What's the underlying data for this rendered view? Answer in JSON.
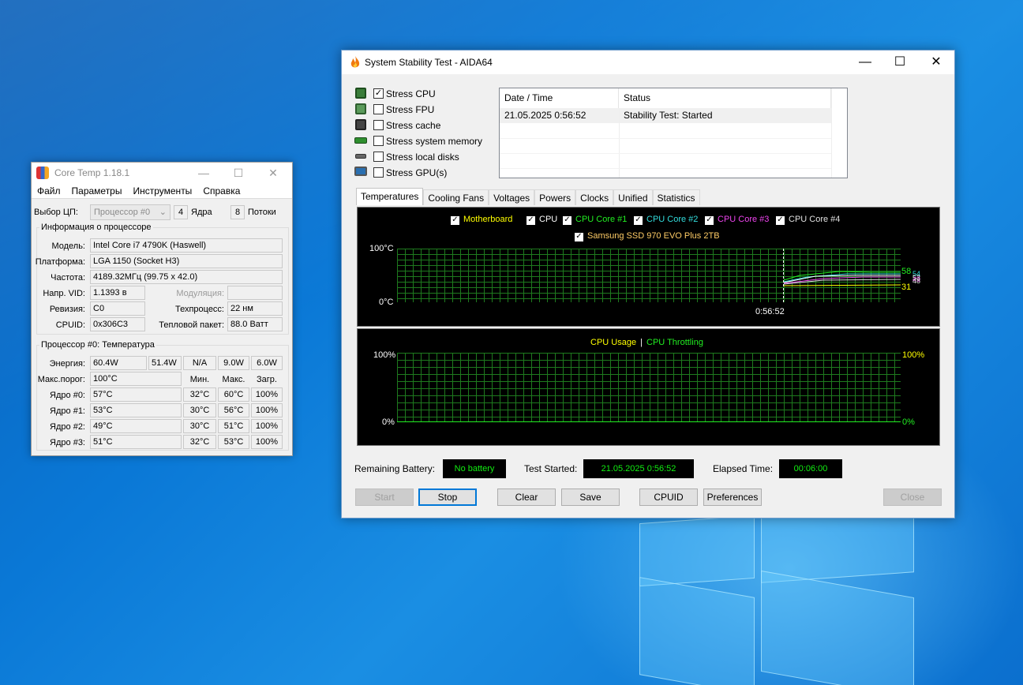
{
  "coretemp": {
    "title": "Core Temp 1.18.1",
    "menu": [
      "Файл",
      "Параметры",
      "Инструменты",
      "Справка"
    ],
    "cpu_select_label": "Выбор ЦП:",
    "cpu_select_value": "Процессор #0",
    "cores_value": "4",
    "cores_label": "Ядра",
    "threads_value": "8",
    "threads_label": "Потоки",
    "info_group": "Информация о процессоре",
    "model_label": "Модель:",
    "model_value": "Intel Core i7 4790K (Haswell)",
    "platform_label": "Платформа:",
    "platform_value": "LGA 1150 (Socket H3)",
    "freq_label": "Частота:",
    "freq_value": "4189.32МГц (99.75 x 42.0)",
    "vid_label": "Напр. VID:",
    "vid_value": "1.1393 в",
    "mod_label": "Модуляция:",
    "mod_value": "",
    "rev_label": "Ревизия:",
    "rev_value": "C0",
    "proc_label": "Техпроцесс:",
    "proc_value": "22 нм",
    "cpuid_label": "CPUID:",
    "cpuid_value": "0x306C3",
    "tdp_label": "Тепловой пакет:",
    "tdp_value": "88.0 Ватт",
    "temp_group": "Процессор #0: Температура",
    "power_label": "Энергия:",
    "power_values": [
      "60.4W",
      "51.4W",
      "N/A",
      "9.0W",
      "6.0W"
    ],
    "tjmax_label": "Макс.порог:",
    "tjmax_value": "100°C",
    "col_min": "Мин.",
    "col_max": "Макс.",
    "col_load": "Загр.",
    "cores": [
      {
        "label": "Ядро #0:",
        "temp": "57°C",
        "min": "32°C",
        "max": "60°C",
        "load": "100%"
      },
      {
        "label": "Ядро #1:",
        "temp": "53°C",
        "min": "30°C",
        "max": "56°C",
        "load": "100%"
      },
      {
        "label": "Ядро #2:",
        "temp": "49°C",
        "min": "30°C",
        "max": "51°C",
        "load": "100%"
      },
      {
        "label": "Ядро #3:",
        "temp": "51°C",
        "min": "32°C",
        "max": "53°C",
        "load": "100%"
      }
    ]
  },
  "aida": {
    "title": "System Stability Test - AIDA64",
    "stress": [
      {
        "label": "Stress CPU",
        "checked": "✓"
      },
      {
        "label": "Stress FPU",
        "checked": ""
      },
      {
        "label": "Stress cache",
        "checked": ""
      },
      {
        "label": "Stress system memory",
        "checked": ""
      },
      {
        "label": "Stress local disks",
        "checked": ""
      },
      {
        "label": "Stress GPU(s)",
        "checked": ""
      }
    ],
    "log": {
      "col_date": "Date / Time",
      "col_status": "Status",
      "rows": [
        {
          "date": "21.05.2025 0:56:52",
          "status": "Stability Test: Started"
        }
      ]
    },
    "tabs": [
      "Temperatures",
      "Cooling Fans",
      "Voltages",
      "Powers",
      "Clocks",
      "Unified",
      "Statistics"
    ],
    "temp_graph": {
      "legend": [
        {
          "label": "Motherboard",
          "color": "#ffff00"
        },
        {
          "label": "CPU",
          "color": "#ffffff"
        },
        {
          "label": "CPU Core #1",
          "color": "#22ee22"
        },
        {
          "label": "CPU Core #2",
          "color": "#33dddd"
        },
        {
          "label": "CPU Core #3",
          "color": "#ee44ee"
        },
        {
          "label": "CPU Core #4",
          "color": "#e0e0e0"
        },
        {
          "label": "Samsung SSD 970 EVO Plus 2TB",
          "color": "#ffcc66"
        }
      ],
      "y_top": "100°C",
      "y_bottom": "0°C",
      "time_label": "0:56:52",
      "right_values": [
        {
          "text": "58",
          "color": "#22ee22"
        },
        {
          "text": "54",
          "color": "#33dddd"
        },
        {
          "text": "53",
          "color": "#ffffff"
        },
        {
          "text": "49",
          "color": "#ee44ee"
        },
        {
          "text": "48",
          "color": "#e0e0e0"
        },
        {
          "text": "31",
          "color": "#ffff00"
        }
      ]
    },
    "usage_graph": {
      "legend_usage": "CPU Usage",
      "legend_sep": "|",
      "legend_throttle": "CPU Throttling",
      "y_top_left": "100%",
      "y_bottom_left": "0%",
      "y_top_right": "100%",
      "y_bottom_right": "0%"
    },
    "battery_label": "Remaining Battery:",
    "battery_value": "No battery",
    "started_label": "Test Started:",
    "started_value": "21.05.2025 0:56:52",
    "elapsed_label": "Elapsed Time:",
    "elapsed_value": "00:06:00",
    "buttons": {
      "start": "Start",
      "stop": "Stop",
      "clear": "Clear",
      "save": "Save",
      "cpuid": "CPUID",
      "preferences": "Preferences",
      "close": "Close"
    }
  }
}
